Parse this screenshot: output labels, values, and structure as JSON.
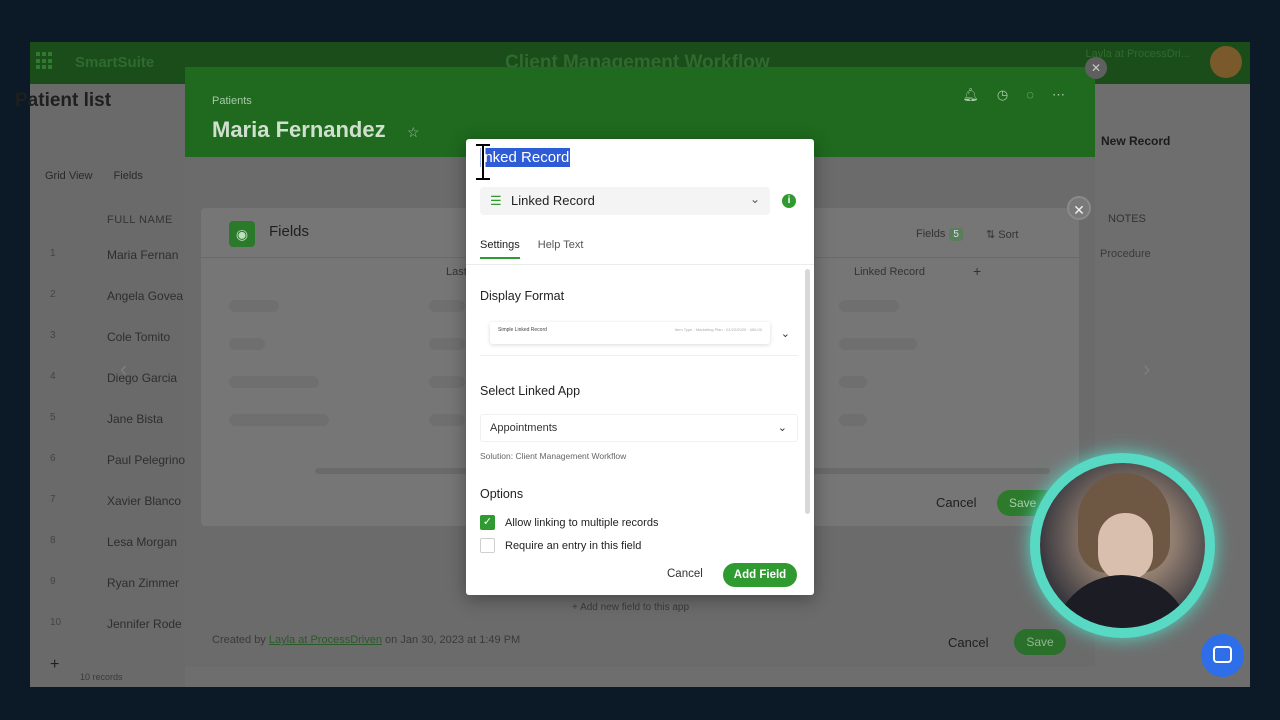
{
  "app": {
    "logo": "SmartSuite",
    "title": "Client Management Workflow",
    "user": "Layla at ProcessDri..."
  },
  "list": {
    "title": "Patient list",
    "tools": [
      "Grid View",
      "Fields"
    ],
    "column_header": "FULL NAME",
    "rows": [
      {
        "n": "1",
        "name": "Maria Fernan"
      },
      {
        "n": "2",
        "name": "Angela Govea"
      },
      {
        "n": "3",
        "name": "Cole Tomito"
      },
      {
        "n": "4",
        "name": "Diego Garcia"
      },
      {
        "n": "5",
        "name": "Jane Bista"
      },
      {
        "n": "6",
        "name": "Paul Pelegrino"
      },
      {
        "n": "7",
        "name": "Xavier Blanco"
      },
      {
        "n": "8",
        "name": "Lesa Morgan"
      },
      {
        "n": "9",
        "name": "Ryan Zimmer"
      },
      {
        "n": "10",
        "name": "Jennifer Rode"
      }
    ],
    "record_count": "10 records"
  },
  "record": {
    "breadcrumb": "Patients",
    "name": "Maria Fernandez",
    "new_record": "New Record",
    "right_column": "NOTES",
    "right_cell": "Procedure",
    "created_prefix": "Created by",
    "created_by": "Layla at ProcessDriven",
    "created_suffix": "on Jan 30, 2023 at 1:49 PM",
    "add_new_field": "+ Add new field to this app",
    "cancel": "Cancel",
    "save": "Save"
  },
  "fields_dialog": {
    "title": "Fields",
    "fields_label": "Fields",
    "fields_count": "5",
    "sort": "Sort",
    "col_last": "Last",
    "col_linked": "Linked Record",
    "cancel": "Cancel",
    "save": "Save"
  },
  "modal": {
    "field_name_selected": "inked Record",
    "field_type": "Linked Record",
    "tabs": [
      "Settings",
      "Help Text"
    ],
    "display_format_title": "Display Format",
    "display_format_preview": "Simple Linked Record",
    "display_format_preview_meta": "Item Type · Marketing Plan · 01/22/2020 · 456.00",
    "select_app_title": "Select Linked App",
    "selected_app": "Appointments",
    "solution_note": "Solution: Client Management Workflow",
    "options_title": "Options",
    "options": [
      {
        "label": "Allow linking to multiple records",
        "checked": true
      },
      {
        "label": "Require an entry in this field",
        "checked": false
      }
    ],
    "cancel": "Cancel",
    "add_field": "Add Field"
  },
  "colors": {
    "accent": "#2f9a2f",
    "selection": "#2e5bd6",
    "webcam_ring": "#57d9c4",
    "chat": "#2e6ee8"
  }
}
